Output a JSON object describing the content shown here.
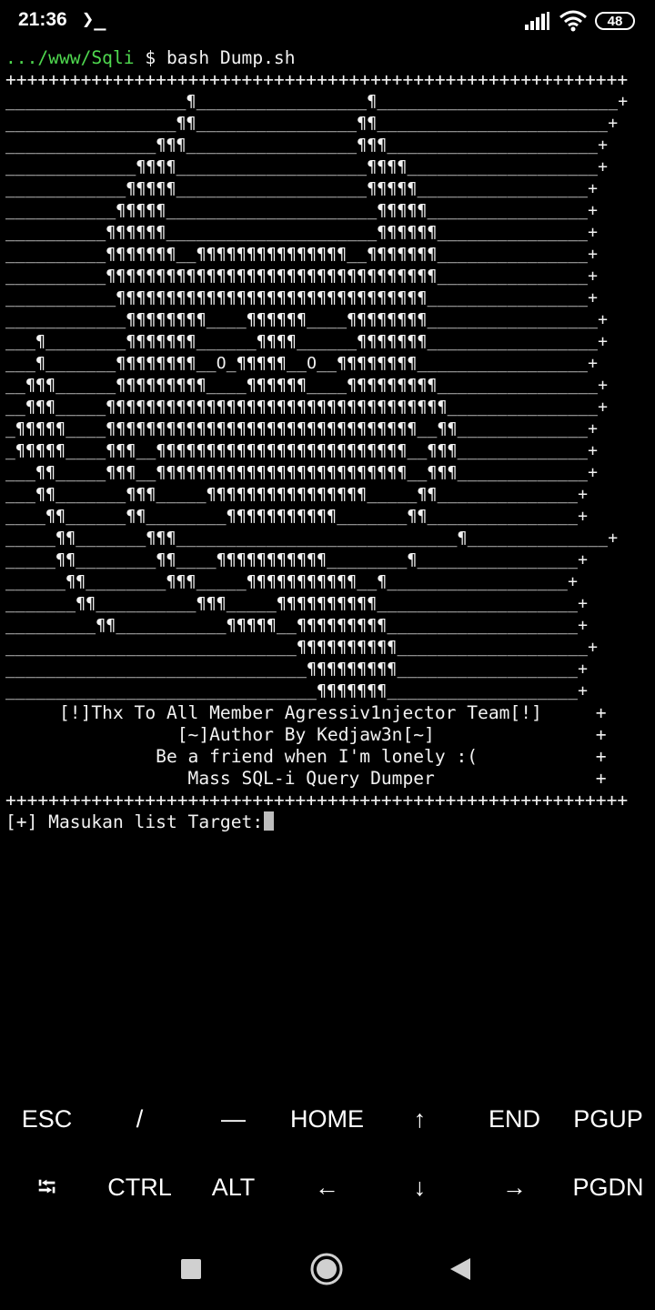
{
  "status_bar": {
    "time": "21:36",
    "terminal_icon_glyph": "❯_",
    "battery_level": "48",
    "icons": [
      "terminal-icon",
      "signal-icon",
      "wifi-icon",
      "battery-icon"
    ]
  },
  "terminal": {
    "prompt": {
      "path": ".../www/Sqli",
      "symbol": "$",
      "command": "bash Dump.sh"
    },
    "border": "++++++++++++++++++++++++++++++++++++++++++++++++++++++++++",
    "art_lines": [
      "__________________¶_________________¶________________________+",
      "_________________¶¶________________¶¶_______________________+",
      "_______________¶¶¶_________________¶¶¶_____________________+",
      "_____________¶¶¶¶___________________¶¶¶¶___________________+",
      "____________¶¶¶¶¶___________________¶¶¶¶¶_________________+",
      "___________¶¶¶¶¶_____________________¶¶¶¶¶________________+",
      "__________¶¶¶¶¶¶_____________________¶¶¶¶¶¶_______________+",
      "__________¶¶¶¶¶¶¶__¶¶¶¶¶¶¶¶¶¶¶¶¶¶¶__¶¶¶¶¶¶¶_______________+",
      "__________¶¶¶¶¶¶¶¶¶¶¶¶¶¶¶¶¶¶¶¶¶¶¶¶¶¶¶¶¶¶¶¶¶_______________+",
      "___________¶¶¶¶¶¶¶¶¶¶¶¶¶¶¶¶¶¶¶¶¶¶¶¶¶¶¶¶¶¶¶________________+",
      "____________¶¶¶¶¶¶¶¶____¶¶¶¶¶¶____¶¶¶¶¶¶¶¶_________________+",
      "___¶________¶¶¶¶¶¶¶______¶¶¶¶______¶¶¶¶¶¶¶_________________+",
      "___¶_______¶¶¶¶¶¶¶¶__O_¶¶¶¶¶__O__¶¶¶¶¶¶¶¶_________________+",
      "__¶¶¶______¶¶¶¶¶¶¶¶¶____¶¶¶¶¶¶____¶¶¶¶¶¶¶¶¶________________+",
      "__¶¶¶_____¶¶¶¶¶¶¶¶¶¶¶¶¶¶¶¶¶¶¶¶¶¶¶¶¶¶¶¶¶¶¶¶¶¶_______________+",
      "_¶¶¶¶¶____¶¶¶¶¶¶¶¶¶¶¶¶¶¶¶¶¶¶¶¶¶¶¶¶¶¶¶¶¶¶¶__¶¶_____________+",
      "_¶¶¶¶¶____¶¶¶__¶¶¶¶¶¶¶¶¶¶¶¶¶¶¶¶¶¶¶¶¶¶¶¶¶__¶¶¶_____________+",
      "___¶¶_____¶¶¶__¶¶¶¶¶¶¶¶¶¶¶¶¶¶¶¶¶¶¶¶¶¶¶¶¶__¶¶¶_____________+",
      "___¶¶_______¶¶¶_____¶¶¶¶¶¶¶¶¶¶¶¶¶¶¶¶_____¶¶______________+",
      "____¶¶______¶¶________¶¶¶¶¶¶¶¶¶¶¶_______¶¶_______________+",
      "_____¶¶_______¶¶¶____________________________¶______________+",
      "_____¶¶________¶¶____¶¶¶¶¶¶¶¶¶¶¶________¶________________+",
      "______¶¶________¶¶¶_____¶¶¶¶¶¶¶¶¶¶¶__¶__________________+",
      "_______¶¶__________¶¶¶_____¶¶¶¶¶¶¶¶¶¶____________________+",
      "_________¶¶___________¶¶¶¶¶__¶¶¶¶¶¶¶¶¶___________________+",
      "_____________________________¶¶¶¶¶¶¶¶¶¶___________________+",
      "______________________________¶¶¶¶¶¶¶¶¶__________________+",
      "_______________________________¶¶¶¶¶¶¶___________________+"
    ],
    "credits": [
      "     [!]Thx To All Member Agressiv1njector Team[!]     +",
      "                [~]Author By Kedjaw3n[~]               +",
      "              Be a friend when I'm lonely :(           +",
      "                 Mass SQL-i Query Dumper               +"
    ],
    "input_prompt": "[+] Masukan list Target:"
  },
  "extra_keys": {
    "row1": [
      "ESC",
      "/",
      "—",
      "HOME",
      "↑",
      "END",
      "PGUP"
    ],
    "row2": [
      "⭾",
      "CTRL",
      "ALT",
      "←",
      "↓",
      "→",
      "PGDN"
    ]
  },
  "nav_bar": {
    "buttons": [
      "recents-button",
      "home-button",
      "back-button"
    ]
  }
}
